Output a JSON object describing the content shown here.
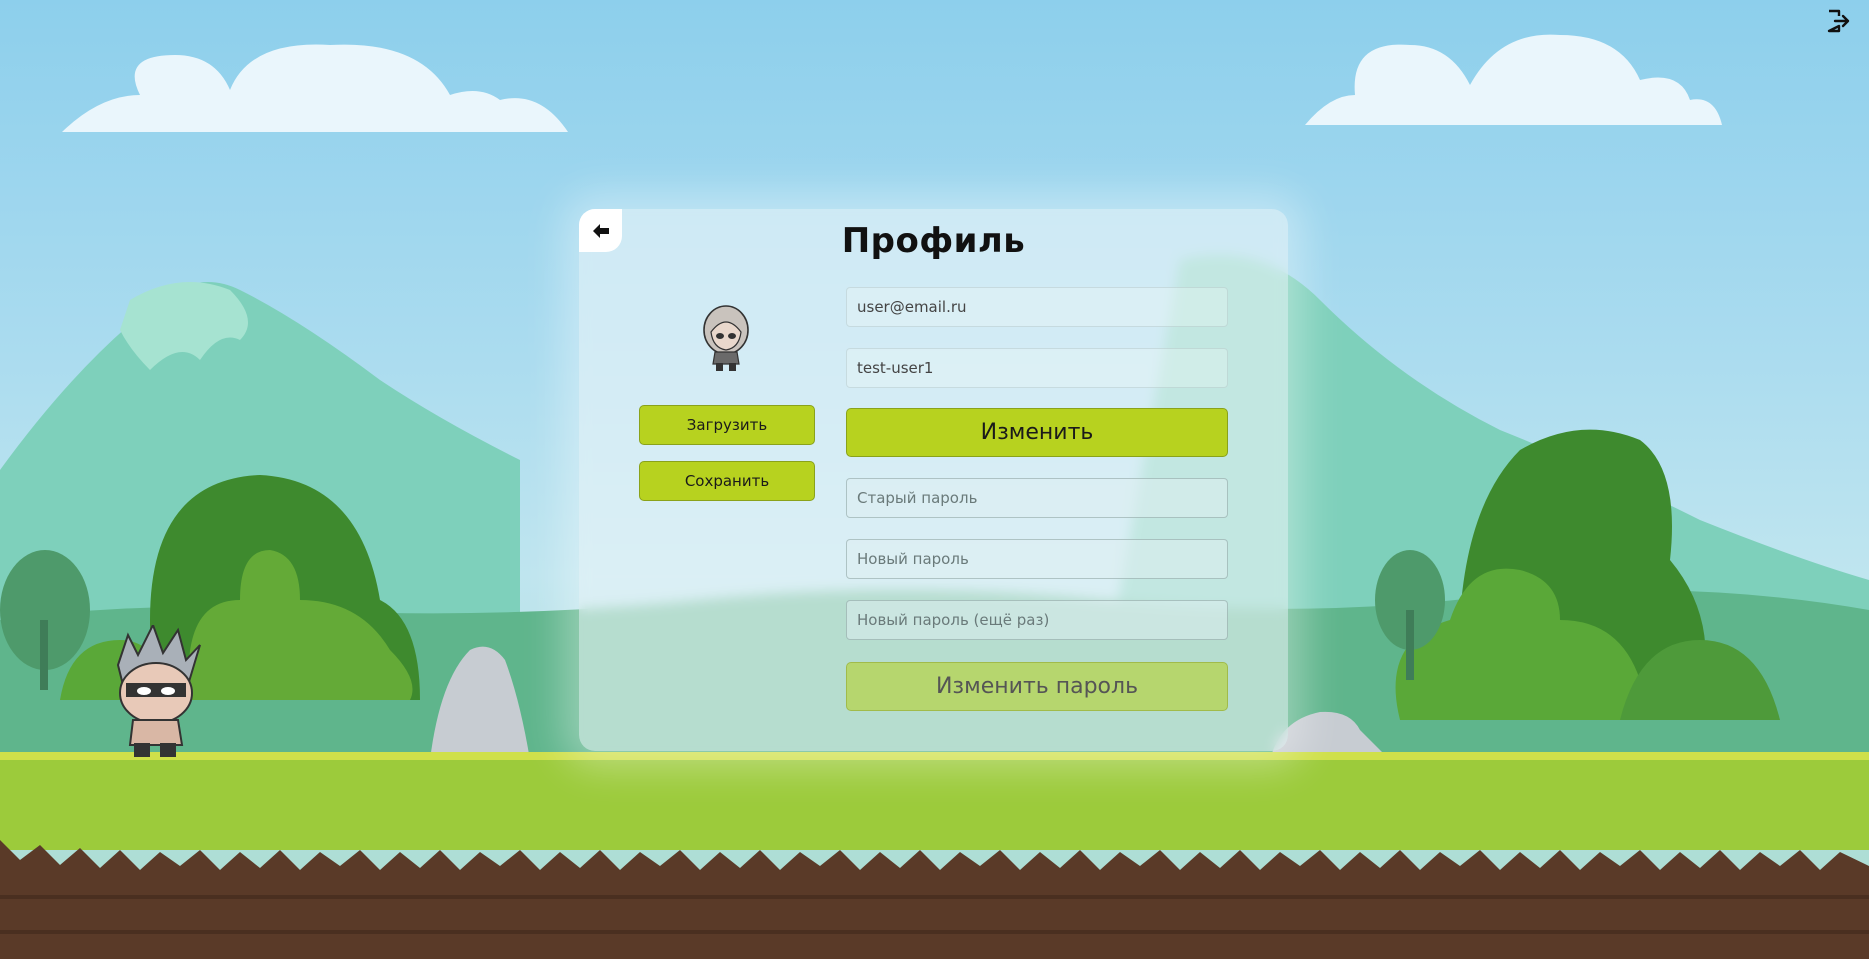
{
  "header": {
    "logout_icon": "logout-icon"
  },
  "profile": {
    "title": "Профиль",
    "back_icon": "arrow-left-icon",
    "upload_label": "Загрузить",
    "save_label": "Сохранить",
    "email_value": "user@email.ru",
    "username_value": "test-user1",
    "change_label": "Изменить",
    "old_password_placeholder": "Старый пароль",
    "new_password_placeholder": "Новый пароль",
    "repeat_password_placeholder": "Новый пароль (ещё раз)",
    "change_password_label": "Изменить пароль"
  },
  "colors": {
    "accent": "#b7d21f",
    "sky": "#8dcfec",
    "grass": "#9ccb3b",
    "soil": "#5a3a28"
  }
}
